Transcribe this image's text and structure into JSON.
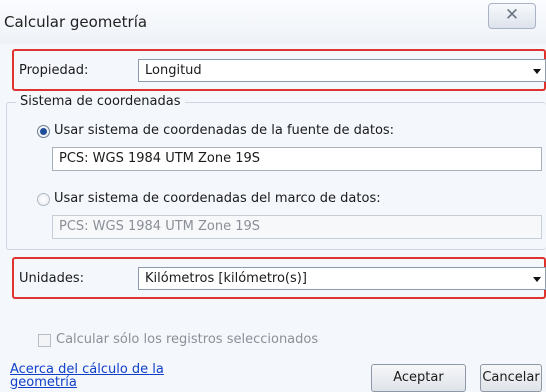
{
  "window": {
    "title": "Calcular geometría",
    "close_glyph": "✕"
  },
  "property": {
    "label": "Propiedad:",
    "value": "Longitud"
  },
  "coordinate_system": {
    "group_label": "Sistema de coordenadas",
    "option_source": {
      "label": "Usar sistema de coordenadas de la fuente de datos:",
      "value": "PCS: WGS 1984 UTM Zone 19S",
      "checked": true
    },
    "option_frame": {
      "label": "Usar sistema de coordenadas del marco de datos:",
      "value": "PCS: WGS 1984 UTM Zone 19S",
      "checked": false
    }
  },
  "units": {
    "label": "Unidades:",
    "value": "Kilómetros [kilómetro(s)]"
  },
  "selected_only": {
    "label": "Calcular sólo los registros seleccionados",
    "checked": false
  },
  "footer": {
    "help_link": "Acerca del cálculo de la geometría",
    "ok_label": "Aceptar",
    "cancel_label": "Cancelar"
  },
  "colors": {
    "highlight_border": "#e0322f",
    "link": "#1140c8",
    "radio_dot": "#1f4f9a"
  }
}
